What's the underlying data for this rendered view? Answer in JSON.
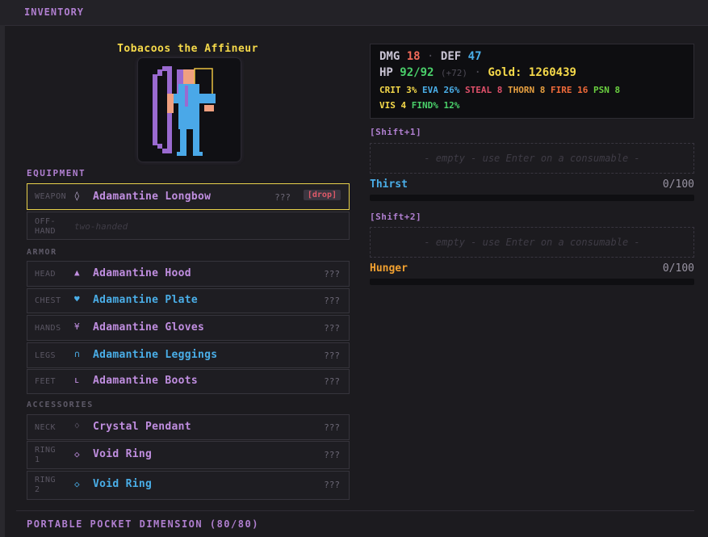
{
  "panel": {
    "title": "INVENTORY"
  },
  "character": {
    "name": "Tobacoos the Affineur"
  },
  "sections": {
    "equipment": "EQUIPMENT",
    "armor": "ARMOR",
    "accessories": "ACCESSORIES",
    "pocket": "PORTABLE POCKET DIMENSION (80/80)"
  },
  "slots": {
    "weapon": {
      "label": "WEAPON",
      "icon": "bow-icon",
      "item": "Adamantine Longbow",
      "quality": "???",
      "drop": "[drop]",
      "color": "#c08ee0"
    },
    "offhand": {
      "label_1": "OFF-",
      "label_2": "HAND",
      "empty": "two-handed"
    },
    "head": {
      "label": "HEAD",
      "icon": "helmet-icon",
      "item": "Adamantine Hood",
      "quality": "???",
      "color": "#c08ee0"
    },
    "chest": {
      "label": "CHEST",
      "icon": "chestplate-icon",
      "item": "Adamantine Plate",
      "quality": "???",
      "color": "#4aaee8"
    },
    "hands": {
      "label": "HANDS",
      "icon": "glove-icon",
      "item": "Adamantine Gloves",
      "quality": "???",
      "color": "#c08ee0"
    },
    "legs": {
      "label": "LEGS",
      "icon": "leggings-icon",
      "item": "Adamantine Leggings",
      "quality": "???",
      "color": "#4aaee8"
    },
    "feet": {
      "label": "FEET",
      "icon": "boot-icon",
      "item": "Adamantine Boots",
      "quality": "???",
      "color": "#c08ee0"
    },
    "neck": {
      "label": "NECK",
      "icon": "pendant-icon",
      "item": "Crystal Pendant",
      "quality": "???",
      "color": "#c08ee0"
    },
    "ring1": {
      "label_1": "RING",
      "label_2": "1",
      "icon": "ring-icon",
      "item": "Void Ring",
      "quality": "???",
      "color": "#c08ee0"
    },
    "ring2": {
      "label_1": "RING",
      "label_2": "2",
      "icon": "ring-icon",
      "item": "Void Ring",
      "quality": "???",
      "color": "#4aaee8"
    }
  },
  "stats": {
    "dmg_label": "DMG",
    "dmg": "18",
    "def_label": "DEF",
    "def": "47",
    "hp_label": "HP",
    "hp": "92/92",
    "hp_bonus": "(+72)",
    "gold_label": "Gold:",
    "gold": "1260439",
    "crit_label": "CRIT",
    "crit": "3%",
    "eva_label": "EVA",
    "eva": "26%",
    "steal_label": "STEAL",
    "steal": "8",
    "thorn_label": "THORN",
    "thorn": "8",
    "fire_label": "FIRE",
    "fire": "16",
    "psn_label": "PSN",
    "psn": "8",
    "vis_label": "VIS",
    "vis": "4",
    "find_label": "FIND%",
    "find": "12%",
    "sep": "·"
  },
  "quickslots": [
    {
      "key": "[Shift+1]",
      "empty": "- empty - use Enter on a consumable -"
    },
    {
      "key": "[Shift+2]",
      "empty": "- empty - use Enter on a consumable -"
    }
  ],
  "meters": {
    "thirst": {
      "label": "Thirst",
      "value": "0/100",
      "fraction": 0,
      "color": "#4aaee8"
    },
    "hunger": {
      "label": "Hunger",
      "value": "0/100",
      "fraction": 0,
      "color": "#f0a030"
    }
  },
  "colors": {
    "accent": "#b07fd0",
    "gold": "#f5d94a",
    "dmg": "#f06a5a",
    "def": "#4aaee8",
    "hp": "#4ad06a"
  }
}
